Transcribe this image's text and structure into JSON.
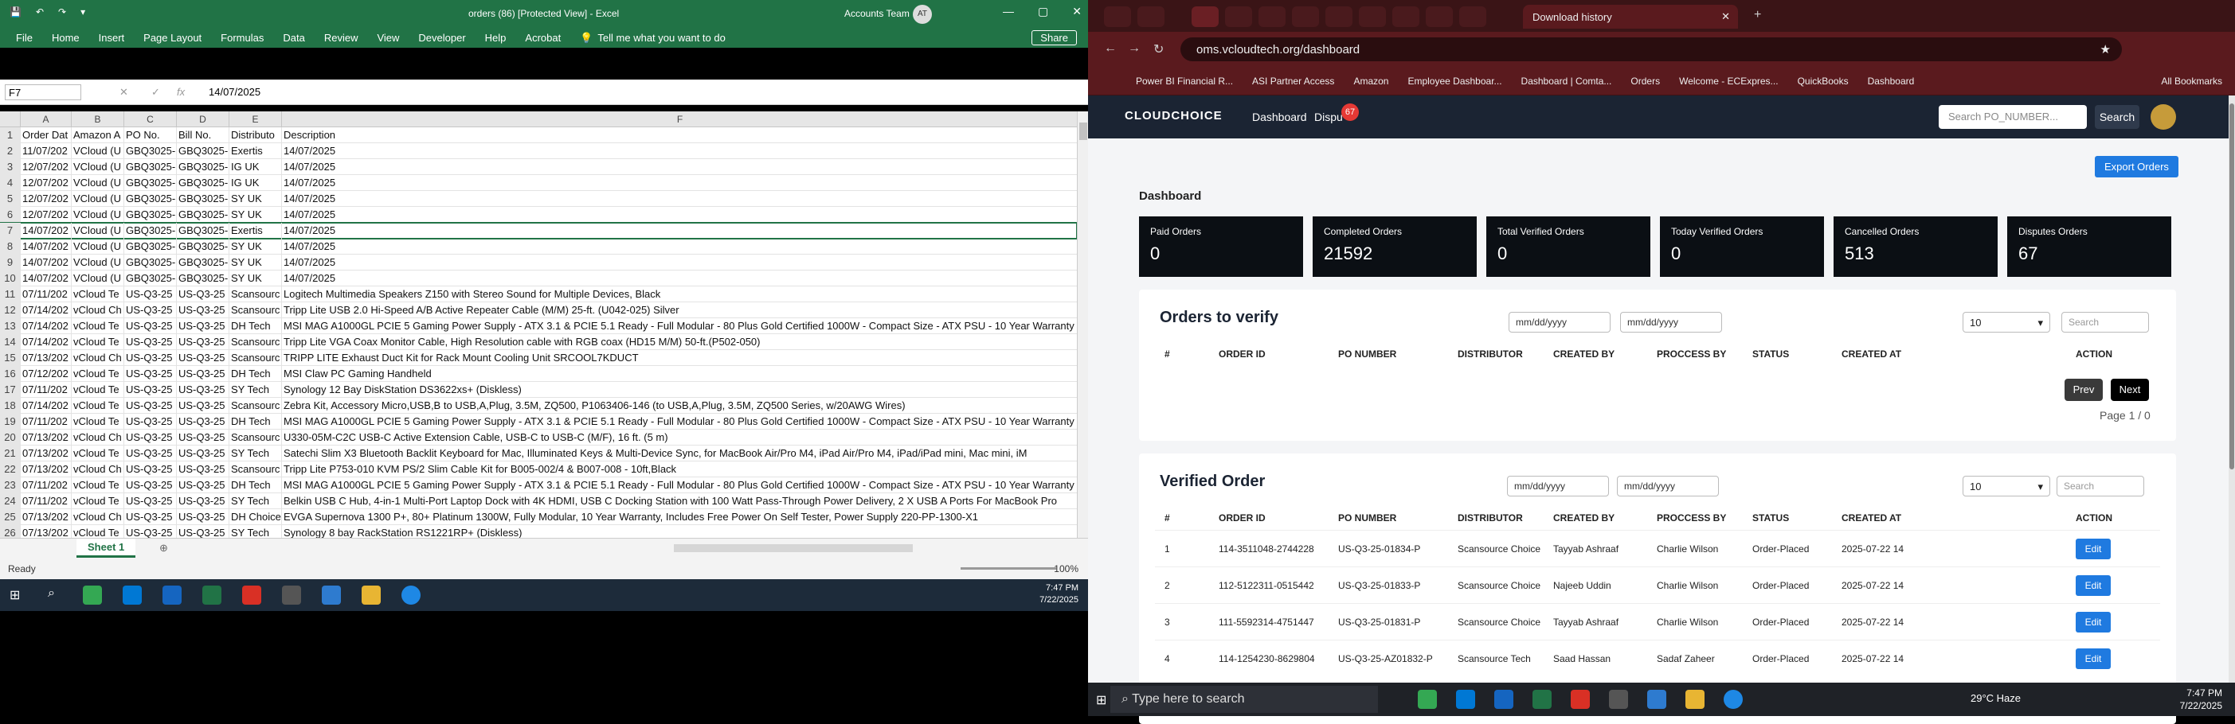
{
  "excel": {
    "qat": [
      "💾",
      "↶",
      "↷",
      "▾"
    ],
    "title": "orders (86)  [Protected View]  -  Excel",
    "account": "Accounts Team",
    "avatar": "AT",
    "window_controls": [
      "—",
      "▢",
      "✕"
    ],
    "ribbon_tabs": [
      "File",
      "Home",
      "Insert",
      "Page Layout",
      "Formulas",
      "Data",
      "Review",
      "View",
      "Developer",
      "Help",
      "Acrobat"
    ],
    "tell_me": "Tell me what you want to do",
    "share": "Share",
    "name_box": "F7",
    "formula_value": "14/07/2025",
    "columns": [
      "A",
      "B",
      "C",
      "D",
      "E",
      "F"
    ],
    "rows": [
      [
        "1",
        "Order Dat",
        "Amazon A",
        "PO No.",
        "Bill No.",
        "Distributo",
        "Description"
      ],
      [
        "2",
        "11/07/202",
        "VCloud (U",
        "GBQ3025-",
        "GBQ3025-",
        "Exertis",
        "14/07/2025"
      ],
      [
        "3",
        "12/07/202",
        "VCloud (U",
        "GBQ3025-",
        "GBQ3025-",
        "IG UK",
        "14/07/2025"
      ],
      [
        "4",
        "12/07/202",
        "VCloud (U",
        "GBQ3025-",
        "GBQ3025-",
        "IG UK",
        "14/07/2025"
      ],
      [
        "5",
        "12/07/202",
        "VCloud (U",
        "GBQ3025-",
        "GBQ3025-",
        "SY UK",
        "14/07/2025"
      ],
      [
        "6",
        "12/07/202",
        "VCloud (U",
        "GBQ3025-",
        "GBQ3025-",
        "SY UK",
        "14/07/2025"
      ],
      [
        "7",
        "14/07/202",
        "VCloud (U",
        "GBQ3025-",
        "GBQ3025-",
        "Exertis",
        "14/07/2025"
      ],
      [
        "8",
        "14/07/202",
        "VCloud (U",
        "GBQ3025-",
        "GBQ3025-",
        "SY UK",
        "14/07/2025"
      ],
      [
        "9",
        "14/07/202",
        "VCloud (U",
        "GBQ3025-",
        "GBQ3025-",
        "SY UK",
        "14/07/2025"
      ],
      [
        "10",
        "14/07/202",
        "VCloud (U",
        "GBQ3025-",
        "GBQ3025-",
        "SY UK",
        "14/07/2025"
      ],
      [
        "11",
        "07/11/202",
        "vCloud Te",
        "US-Q3-25",
        "US-Q3-25",
        "Scansourc",
        "Logitech Multimedia Speakers Z150 with Stereo Sound for Multiple Devices, Black"
      ],
      [
        "12",
        "07/14/202",
        "vCloud Ch",
        "US-Q3-25",
        "US-Q3-25",
        "Scansourc",
        "Tripp Lite USB 2.0 Hi-Speed A/B Active Repeater Cable (M/M) 25-ft. (U042-025) Silver"
      ],
      [
        "13",
        "07/14/202",
        "vCloud Te",
        "US-Q3-25",
        "US-Q3-25",
        "DH Tech",
        "MSI MAG A1000GL PCIE 5 Gaming Power Supply - ATX 3.1 & PCIE 5.1 Ready - Full Modular - 80 Plus Gold Certified 1000W - Compact Size - ATX PSU - 10 Year Warranty"
      ],
      [
        "14",
        "07/14/202",
        "vCloud Te",
        "US-Q3-25",
        "US-Q3-25",
        "Scansourc",
        "Tripp Lite VGA Coax Monitor Cable, High Resolution cable with RGB coax (HD15 M/M) 50-ft.(P502-050)"
      ],
      [
        "15",
        "07/13/202",
        "vCloud Ch",
        "US-Q3-25",
        "US-Q3-25",
        "Scansourc",
        "TRIPP LITE Exhaust Duct Kit for Rack Mount Cooling Unit SRCOOL7KDUCT"
      ],
      [
        "16",
        "07/12/202",
        "vCloud Te",
        "US-Q3-25",
        "US-Q3-25",
        "DH Tech",
        "MSI Claw PC Gaming Handheld"
      ],
      [
        "17",
        "07/11/202",
        "vCloud Te",
        "US-Q3-25",
        "US-Q3-25",
        "SY Tech",
        "Synology 12 Bay DiskStation DS3622xs+ (Diskless)"
      ],
      [
        "18",
        "07/14/202",
        "vCloud Te",
        "US-Q3-25",
        "US-Q3-25",
        "Scansourc",
        "Zebra Kit, Accessory Micro,USB,B to USB,A,Plug, 3.5M, ZQ500, P1063406-146 (to USB,A,Plug, 3.5M, ZQ500 Series, w/20AWG Wires)"
      ],
      [
        "19",
        "07/11/202",
        "vCloud Te",
        "US-Q3-25",
        "US-Q3-25",
        "DH Tech",
        "MSI MAG A1000GL PCIE 5 Gaming Power Supply - ATX 3.1 & PCIE 5.1 Ready - Full Modular - 80 Plus Gold Certified 1000W - Compact Size - ATX PSU - 10 Year Warranty"
      ],
      [
        "20",
        "07/13/202",
        "vCloud Ch",
        "US-Q3-25",
        "US-Q3-25",
        "Scansourc",
        "U330-05M-C2C USB-C Active Extension Cable, USB-C to USB-C (M/F), 16 ft. (5 m)"
      ],
      [
        "21",
        "07/13/202",
        "vCloud Te",
        "US-Q3-25",
        "US-Q3-25",
        "SY Tech",
        "Satechi Slim X3 Bluetooth Backlit Keyboard for Mac, Illuminated Keys & Multi-Device Sync, for MacBook Air/Pro M4, iPad Air/Pro M4, iPad/iPad mini, Mac mini, iM"
      ],
      [
        "22",
        "07/13/202",
        "vCloud Ch",
        "US-Q3-25",
        "US-Q3-25",
        "Scansourc",
        "Tripp Lite P753-010 KVM PS/2 Slim Cable Kit for B005-002/4 & B007-008 - 10ft,Black"
      ],
      [
        "23",
        "07/11/202",
        "vCloud Te",
        "US-Q3-25",
        "US-Q3-25",
        "DH Tech",
        "MSI MAG A1000GL PCIE 5 Gaming Power Supply - ATX 3.1 & PCIE 5.1 Ready - Full Modular - 80 Plus Gold Certified 1000W - Compact Size - ATX PSU - 10 Year Warranty"
      ],
      [
        "24",
        "07/11/202",
        "vCloud Te",
        "US-Q3-25",
        "US-Q3-25",
        "SY Tech",
        "Belkin USB C Hub, 4-in-1 Multi-Port Laptop Dock with 4K HDMI, USB C Docking Station with 100 Watt Pass-Through Power Delivery, 2 X USB A Ports For MacBook Pro"
      ],
      [
        "25",
        "07/13/202",
        "vCloud Ch",
        "US-Q3-25",
        "US-Q3-25",
        "DH Choice",
        "EVGA Supernova 1300 P+, 80+ Platinum 1300W, Fully Modular, 10 Year Warranty, Includes Free Power On Self Tester, Power Supply 220-PP-1300-X1"
      ],
      [
        "26",
        "07/13/202",
        "vCloud Te",
        "US-Q3-25",
        "US-Q3-25",
        "SY Tech",
        "Synology 8 bay RackStation RS1221RP+ (Diskless)"
      ]
    ],
    "sheet_tab": "Sheet 1",
    "status": "Ready",
    "zoom": "100%",
    "time": "7:47 PM",
    "date": "7/22/2025"
  },
  "chrome": {
    "history_tab": "Download history",
    "url": "oms.vcloudtech.org/dashboard",
    "bookmarks": [
      "Power BI Financial R...",
      "ASI Partner Access",
      "Amazon",
      "Employee Dashboar...",
      "Dashboard | Comta...",
      "Orders",
      "Welcome - ECExpres...",
      "QuickBooks",
      "Dashboard"
    ],
    "all_bookmarks": "All Bookmarks"
  },
  "app": {
    "logo": "CLOUDCHOICE",
    "nav_dashboard": "Dashboard",
    "nav_disputes": "Dispu",
    "disputes_badge": "67",
    "search_placeholder": "Search PO_NUMBER...",
    "search_btn": "Search",
    "export_btn": "Export Orders",
    "page_title": "Dashboard",
    "cards": [
      {
        "label": "Paid Orders",
        "value": "0"
      },
      {
        "label": "Completed Orders",
        "value": "21592"
      },
      {
        "label": "Total Verified Orders",
        "value": "0"
      },
      {
        "label": "Today Verified Orders",
        "value": "0"
      },
      {
        "label": "Cancelled Orders",
        "value": "513"
      },
      {
        "label": "Disputes Orders",
        "value": "67"
      }
    ],
    "date_placeholder": "mm/dd/yyyy",
    "per_page": "10",
    "table_search": "Search",
    "verify": {
      "title": "Orders to verify",
      "headers": [
        "#",
        "ORDER ID",
        "PO NUMBER",
        "DISTRIBUTOR",
        "CREATED BY",
        "PROCCESS BY",
        "STATUS",
        "CREATED AT",
        "ACTION"
      ],
      "prev": "Prev",
      "next": "Next",
      "page": "Page 1 / 0"
    },
    "verified": {
      "title": "Verified Order",
      "headers": [
        "#",
        "ORDER ID",
        "PO NUMBER",
        "DISTRIBUTOR",
        "CREATED BY",
        "PROCCESS BY",
        "STATUS",
        "CREATED AT",
        "ACTION"
      ],
      "rows": [
        [
          "1",
          "114-3511048-2744228",
          "US-Q3-25-01834-P",
          "Scansource Choice",
          "Tayyab Ashraaf",
          "Charlie Wilson",
          "Order-Placed",
          "2025-07-22 14",
          "Edit"
        ],
        [
          "2",
          "112-5122311-0515442",
          "US-Q3-25-01833-P",
          "Scansource Choice",
          "Najeeb Uddin",
          "Charlie Wilson",
          "Order-Placed",
          "2025-07-22 14",
          "Edit"
        ],
        [
          "3",
          "111-5592314-4751447",
          "US-Q3-25-01831-P",
          "Scansource Choice",
          "Tayyab Ashraaf",
          "Charlie Wilson",
          "Order-Placed",
          "2025-07-22 14",
          "Edit"
        ],
        [
          "4",
          "114-1254230-8629804",
          "US-Q3-25-AZ01832-P",
          "Scansource Tech",
          "Saad Hassan",
          "Sadaf Zaheer",
          "Order-Placed",
          "2025-07-22 14",
          "Edit"
        ]
      ]
    }
  },
  "taskbar": {
    "search": "Type here to search",
    "weather": "29°C  Haze",
    "time": "7:47 PM",
    "date": "7/22/2025"
  },
  "colors": {
    "excel_green": "#217346",
    "brand_nav": "#1b2433",
    "accent_blue": "#1f7ae0",
    "chrome_dark": "#5a1a1e",
    "badge_red": "#e53935"
  }
}
